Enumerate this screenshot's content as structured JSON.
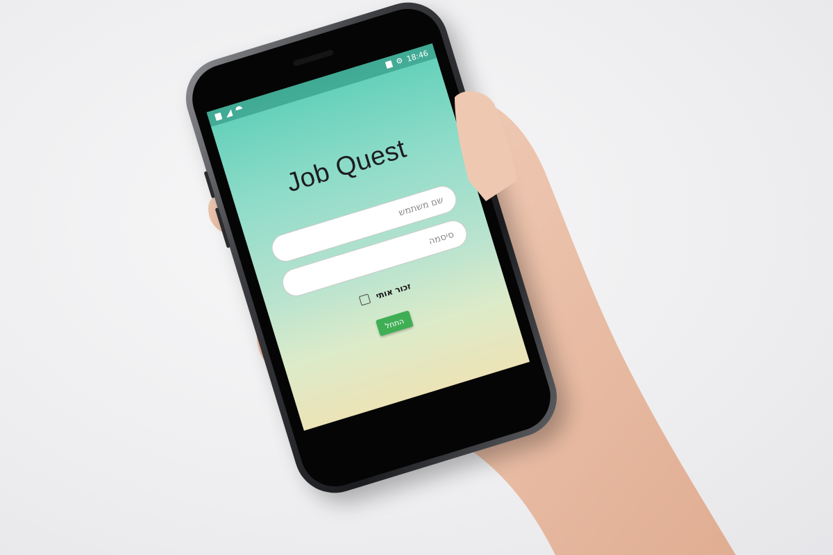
{
  "status_bar": {
    "time": "18:46",
    "left_icons": [
      "battery-saver-icon",
      "signal-icon",
      "wifi-icon"
    ],
    "right_icons": [
      "battery-icon",
      "settings-icon"
    ]
  },
  "app": {
    "title": "Job Quest",
    "username_placeholder": "שם משתמש",
    "password_placeholder": "סיסמה",
    "remember_label": "זכור אותי",
    "start_button": "התחל"
  },
  "colors": {
    "gradient_top": "#5fcfb8",
    "gradient_bottom": "#ece3b7",
    "button": "#3fae55"
  }
}
